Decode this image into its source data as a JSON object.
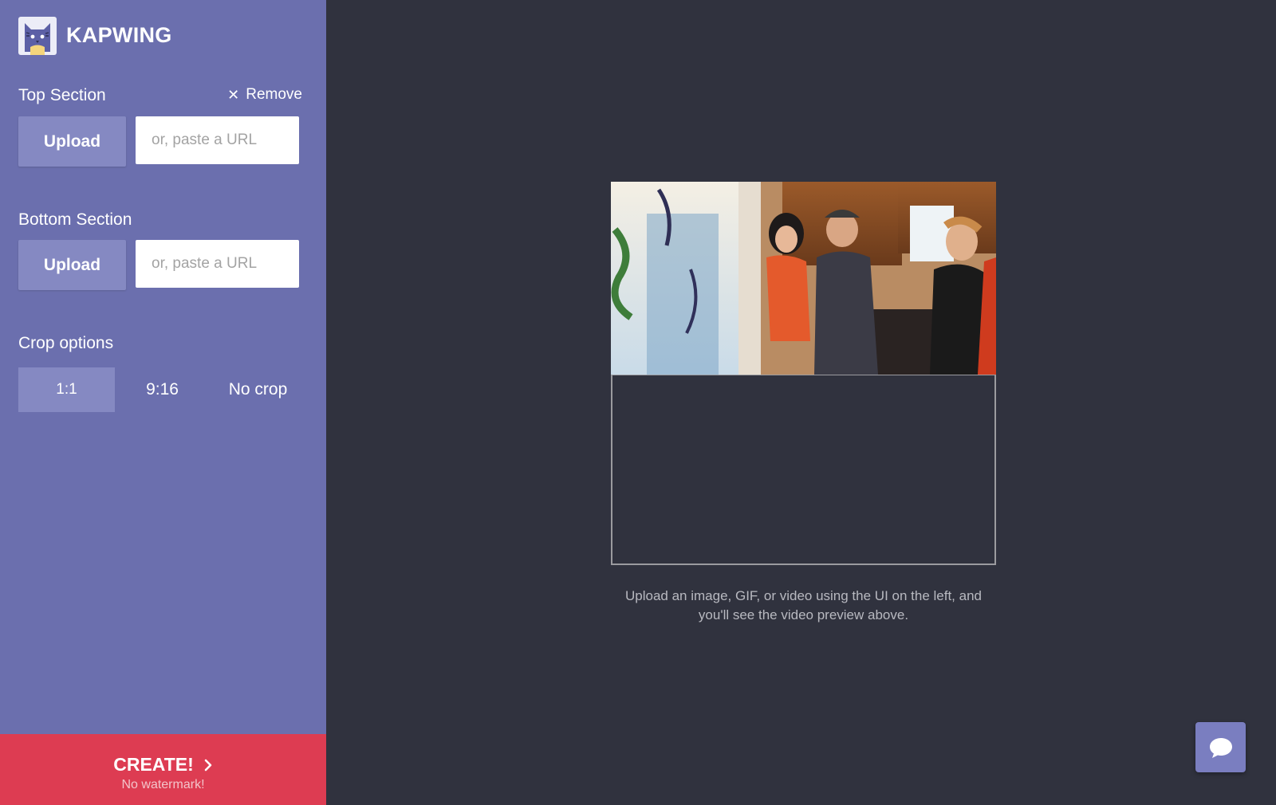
{
  "brand": {
    "name": "KAPWING"
  },
  "top_section": {
    "label": "Top Section",
    "remove_label": "Remove",
    "upload_label": "Upload",
    "url_placeholder": "or, paste a URL"
  },
  "bottom_section": {
    "label": "Bottom Section",
    "upload_label": "Upload",
    "url_placeholder": "or, paste a URL"
  },
  "crop": {
    "label": "Crop options",
    "options": [
      "1:1",
      "9:16",
      "No crop"
    ],
    "selected": "1:1"
  },
  "create": {
    "label": "CREATE!",
    "sublabel": "No watermark!"
  },
  "preview": {
    "hint": "Upload an image, GIF, or video using the UI on the left, and you'll see the video preview above."
  },
  "colors": {
    "sidebar": "#6b6fae",
    "button": "#8589c2",
    "create": "#dd3c52",
    "background": "#30323e"
  },
  "icons": {
    "logo": "cat-logo-icon",
    "remove": "close-icon",
    "create": "chevron-right-icon",
    "chat": "chat-bubble-icon"
  }
}
